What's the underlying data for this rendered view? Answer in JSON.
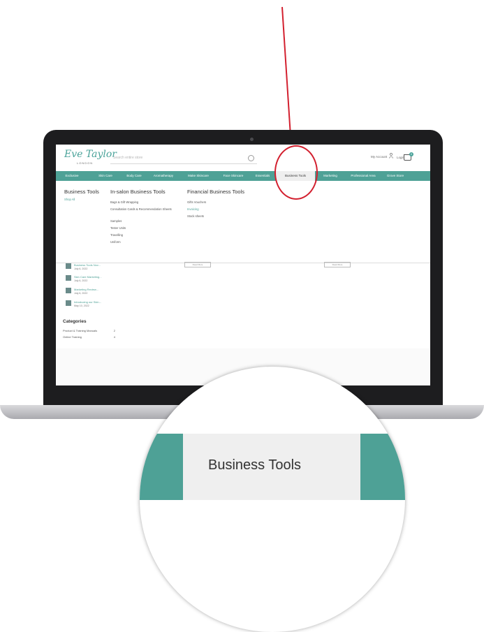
{
  "header": {
    "logo_text": "Eve Taylor",
    "logo_subtext": "LONDON",
    "search_placeholder": "Search entire store",
    "account_label": "My Account",
    "login_label": "Login",
    "cart_count": "0"
  },
  "nav": {
    "items": [
      "Exclusive",
      "Skin Care",
      "Body Care",
      "Aromatherapy",
      "Make Skincare",
      "Face Skincare",
      "Essentials",
      "Business Tools",
      "Marketing",
      "Professional Area",
      "Grove Store"
    ],
    "active": "Business Tools"
  },
  "mega_menu": {
    "col1": {
      "title": "Business Tools",
      "links": [
        "Shop All"
      ]
    },
    "col2": {
      "title": "In-salon Business Tools",
      "links": [
        "Bags & Gift Wrapping",
        "Consultation Cards & Recommendation Sheets",
        "Samples",
        "Tester Units",
        "Travelling",
        "Uniform"
      ]
    },
    "col3": {
      "title": "Financial Business Tools",
      "links": [
        "Gifts Vouchers",
        "Invoicing",
        "Stock sheets"
      ]
    }
  },
  "posts": [
    {
      "title": "Business Tools Nov...",
      "date": "July 6, 2022"
    },
    {
      "title": "Skin Care Marketing...",
      "date": "July 6, 2022"
    },
    {
      "title": "Marketing Review...",
      "date": "July 6, 2022"
    },
    {
      "title": "Introducing our Skin...",
      "date": "May 10, 2022"
    }
  ],
  "buttons": {
    "read_more": "Read More"
  },
  "categories": {
    "heading": "Categories",
    "items": [
      {
        "label": "Product & Training Manuals",
        "count": "2"
      },
      {
        "label": "Online Training",
        "count": "4"
      }
    ]
  },
  "zoom": {
    "label": "Business Tools"
  },
  "colors": {
    "teal": "#4ea196",
    "callout_red": "#d3202f",
    "laptop_body": "#1d1d1f"
  }
}
